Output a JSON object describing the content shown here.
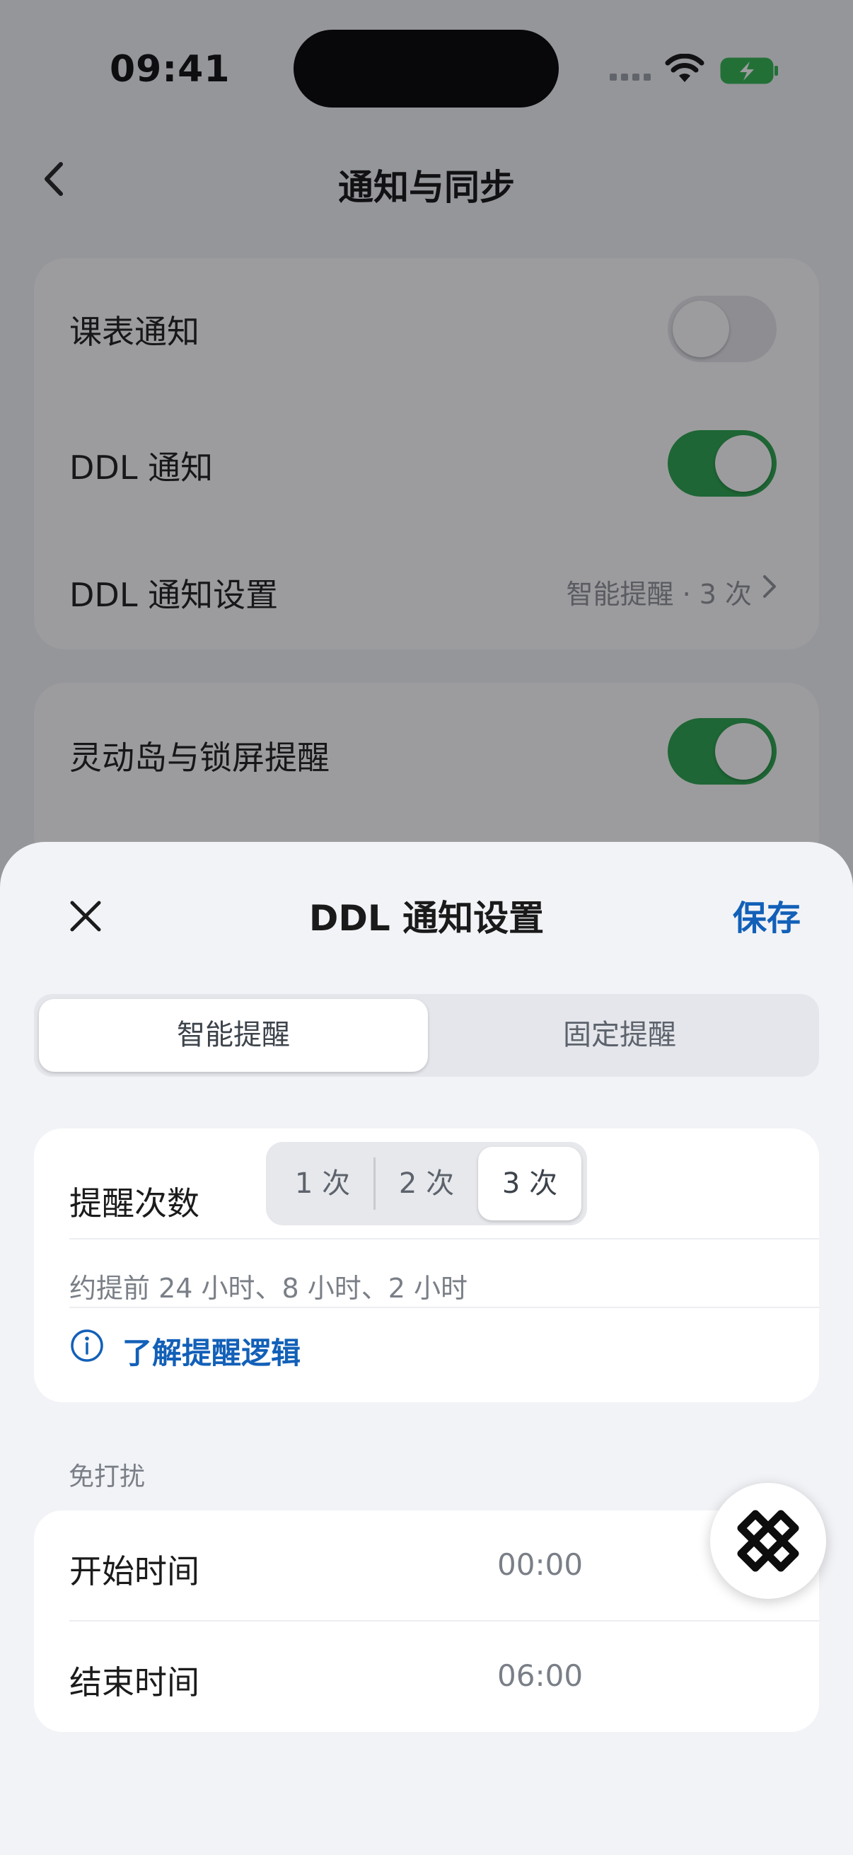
{
  "status_bar": {
    "time": "09:41"
  },
  "background_page": {
    "title": "通知与同步",
    "rows": [
      {
        "label": "课表通知",
        "toggle": "off"
      },
      {
        "label": "DDL 通知",
        "toggle": "on"
      },
      {
        "label": "DDL 通知设置",
        "value": "智能提醒 · 3 次"
      },
      {
        "label": "灵动岛与锁屏提醒",
        "toggle": "on"
      }
    ]
  },
  "sheet": {
    "title": "DDL 通知设置",
    "save_label": "保存",
    "mode_options": [
      "智能提醒",
      "固定提醒"
    ],
    "mode_selected": "智能提醒",
    "count_label": "提醒次数",
    "count_options": [
      "1 次",
      "2 次",
      "3 次"
    ],
    "count_selected": "3 次",
    "count_description": "约提前 24 小时、8 小时、2 小时",
    "logic_link": "了解提醒逻辑",
    "dnd_header": "免打扰",
    "dnd_rows": [
      {
        "label": "开始时间",
        "value": "00:00"
      },
      {
        "label": "结束时间",
        "value": "06:00"
      }
    ]
  },
  "colors": {
    "accent_blue": "#1260b8",
    "toggle_on": "#27a24a"
  }
}
